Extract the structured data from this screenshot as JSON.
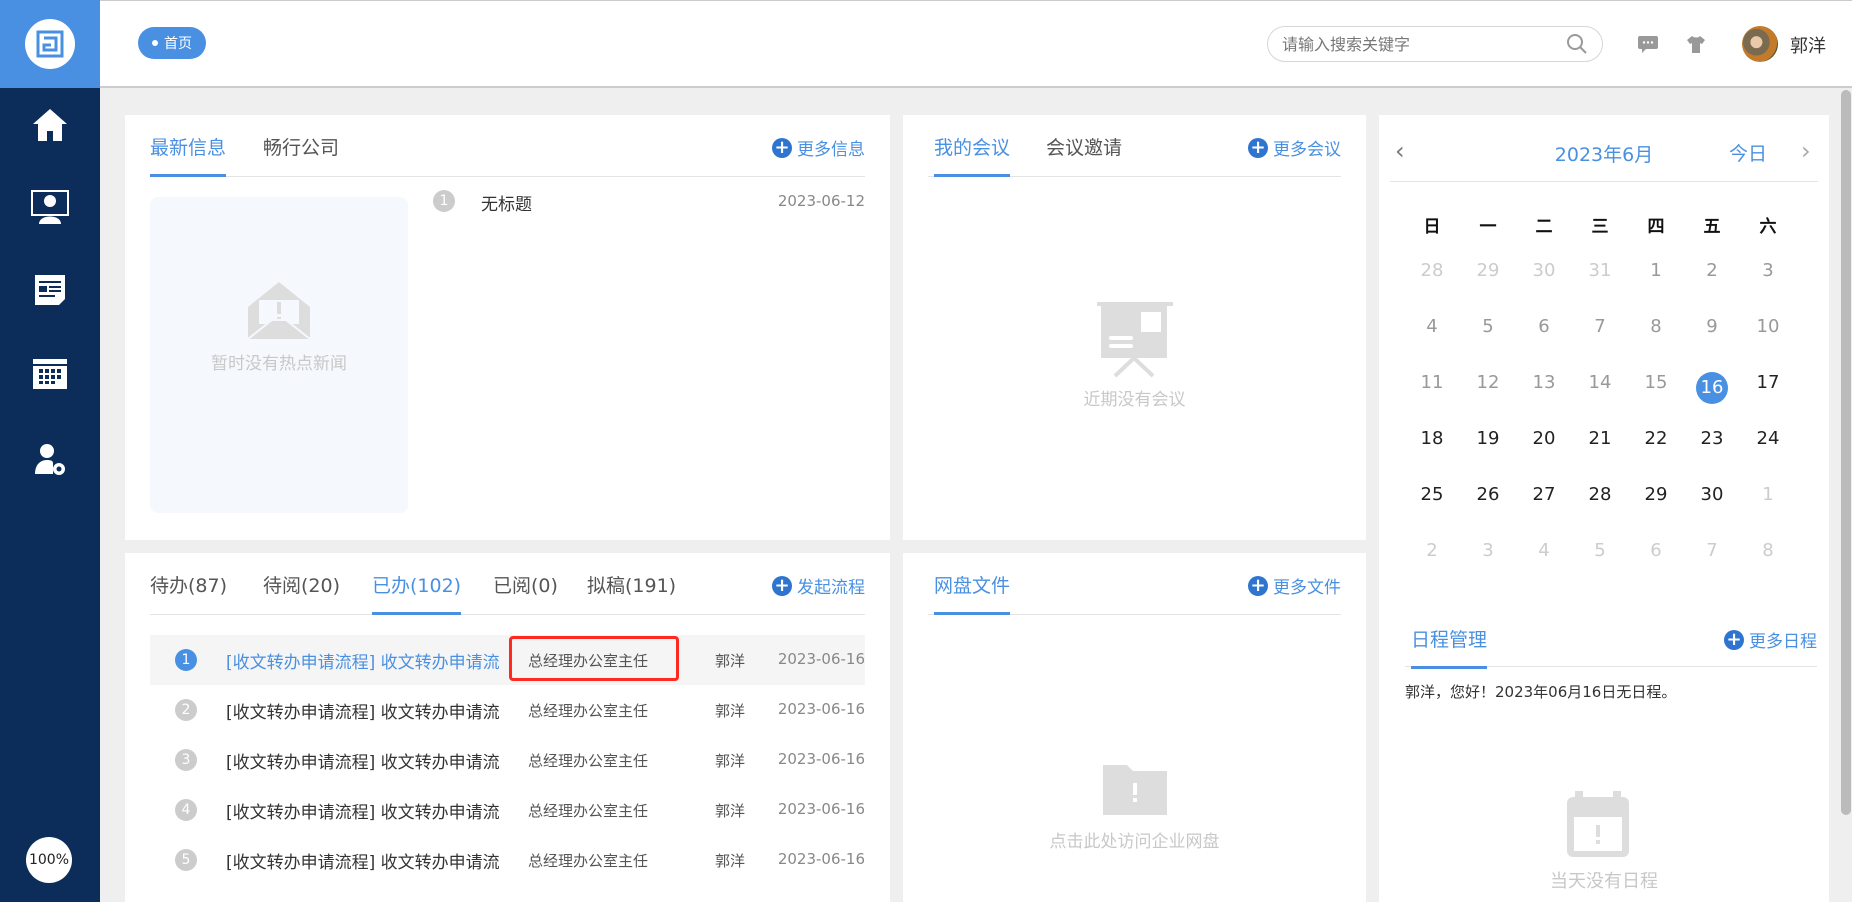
{
  "sidebar": {
    "zoom": "100%"
  },
  "header": {
    "breadcrumb": "首页",
    "search_placeholder": "请输入搜索关键字",
    "user_name": "郭洋"
  },
  "news": {
    "tabs": [
      "最新信息",
      "畅行公司"
    ],
    "more": "更多信息",
    "empty": "暂时没有热点新闻",
    "items": [
      {
        "num": "1",
        "title": "无标题",
        "date": "2023-06-12"
      }
    ]
  },
  "meetings": {
    "tabs": [
      "我的会议",
      "会议邀请"
    ],
    "more": "更多会议",
    "empty": "近期没有会议"
  },
  "workflow": {
    "tabs": [
      "待办(87)",
      "待阅(20)",
      "已办(102)",
      "已阅(0)",
      "拟稿(191)"
    ],
    "active_tab": 2,
    "more": "发起流程",
    "rows": [
      {
        "num": "1",
        "title": "[收文转办申请流程] 收文转办申请流",
        "dept": "总经理办公室主任",
        "who": "郭洋",
        "date": "2023-06-16"
      },
      {
        "num": "2",
        "title": "[收文转办申请流程] 收文转办申请流",
        "dept": "总经理办公室主任",
        "who": "郭洋",
        "date": "2023-06-16"
      },
      {
        "num": "3",
        "title": "[收文转办申请流程] 收文转办申请流",
        "dept": "总经理办公室主任",
        "who": "郭洋",
        "date": "2023-06-16"
      },
      {
        "num": "4",
        "title": "[收文转办申请流程] 收文转办申请流",
        "dept": "总经理办公室主任",
        "who": "郭洋",
        "date": "2023-06-16"
      },
      {
        "num": "5",
        "title": "[收文转办申请流程] 收文转办申请流",
        "dept": "总经理办公室主任",
        "who": "郭洋",
        "date": "2023-06-16"
      }
    ]
  },
  "files": {
    "tabs": [
      "网盘文件"
    ],
    "more": "更多文件",
    "empty": "点击此处访问企业网盘"
  },
  "calendar": {
    "title": "2023年6月",
    "today_label": "今日",
    "prev": "‹",
    "next": "›",
    "weekdays": [
      "日",
      "一",
      "二",
      "三",
      "四",
      "五",
      "六"
    ],
    "weeks": [
      [
        "28",
        "29",
        "30",
        "31",
        "1",
        "2",
        "3"
      ],
      [
        "4",
        "5",
        "6",
        "7",
        "8",
        "9",
        "10"
      ],
      [
        "11",
        "12",
        "13",
        "14",
        "15",
        "16",
        "17"
      ],
      [
        "18",
        "19",
        "20",
        "21",
        "22",
        "23",
        "24"
      ],
      [
        "25",
        "26",
        "27",
        "28",
        "29",
        "30",
        "1"
      ],
      [
        "2",
        "3",
        "4",
        "5",
        "6",
        "7",
        "8"
      ]
    ],
    "selected": "16"
  },
  "schedule": {
    "tab": "日程管理",
    "more": "更多日程",
    "message": "郭洋，您好！2023年06月16日无日程。",
    "empty": "当天没有日程"
  },
  "colors": {
    "accent": "#4a90e2",
    "sidebar": "#0c2d5a",
    "highlight_box": "#ff2a1f"
  }
}
